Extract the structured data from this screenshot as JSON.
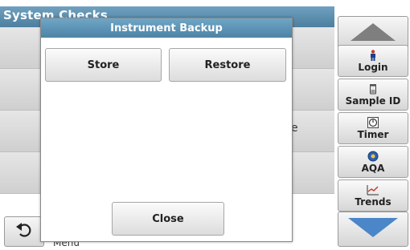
{
  "background": {
    "title": "System Checks",
    "row_partial_text": "e",
    "menu_partial_text": "Menu",
    "back_icon": "undo-arrow-icon"
  },
  "sidebar": {
    "scroll_up_icon": "triangle-up-icon",
    "scroll_down_icon": "triangle-down-icon",
    "items": [
      {
        "label": "Login",
        "icon": "person-icon"
      },
      {
        "label": "Sample ID",
        "icon": "sample-vial-icon"
      },
      {
        "label": "Timer",
        "icon": "stopwatch-icon"
      },
      {
        "label": "AQA",
        "icon": "aqa-globe-icon"
      },
      {
        "label": "Trends",
        "icon": "trend-chart-icon"
      }
    ]
  },
  "dialog": {
    "title": "Instrument Backup",
    "store_label": "Store",
    "restore_label": "Restore",
    "close_label": "Close"
  },
  "colors": {
    "header_blue": "#5a8fb0",
    "arrow_fill": "#7f7f7f",
    "down_arrow_blue": "#4a86c8",
    "button_bg": "#e6e6e6"
  }
}
